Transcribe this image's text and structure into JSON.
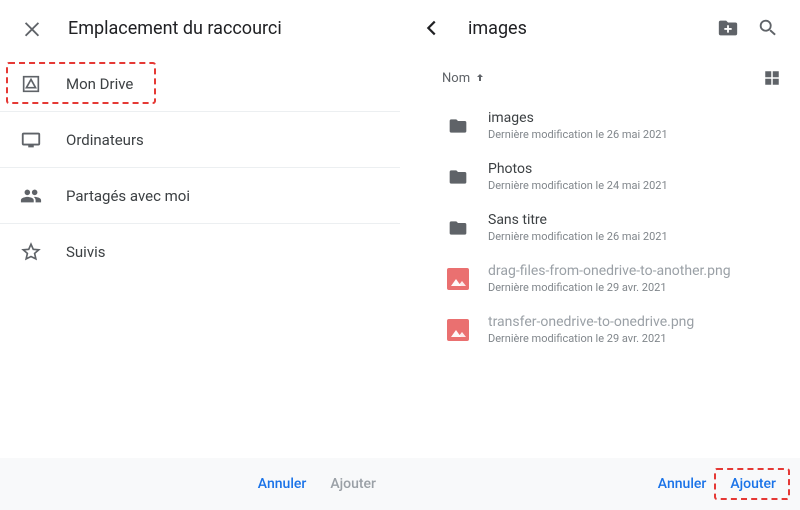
{
  "left": {
    "title": "Emplacement du raccourci",
    "items": [
      {
        "label": "Mon Drive"
      },
      {
        "label": "Ordinateurs"
      },
      {
        "label": "Partagés avec moi"
      },
      {
        "label": "Suivis"
      }
    ],
    "cancel": "Annuler",
    "add": "Ajouter"
  },
  "right": {
    "title": "images",
    "sort_label": "Nom",
    "files": [
      {
        "name": "images",
        "mod": "Dernière modification le 26 mai 2021",
        "type": "folder"
      },
      {
        "name": "Photos",
        "mod": "Dernière modification le 24 mai 2021",
        "type": "folder"
      },
      {
        "name": "Sans titre",
        "mod": "Dernière modification le 26 mai 2021",
        "type": "folder"
      },
      {
        "name": "drag-files-from-onedrive-to-another.png",
        "mod": "Dernière modification le 29 avr. 2021",
        "type": "image"
      },
      {
        "name": "transfer-onedrive-to-onedrive.png",
        "mod": "Dernière modification le 29 avr. 2021",
        "type": "image"
      }
    ],
    "cancel": "Annuler",
    "add": "Ajouter"
  }
}
